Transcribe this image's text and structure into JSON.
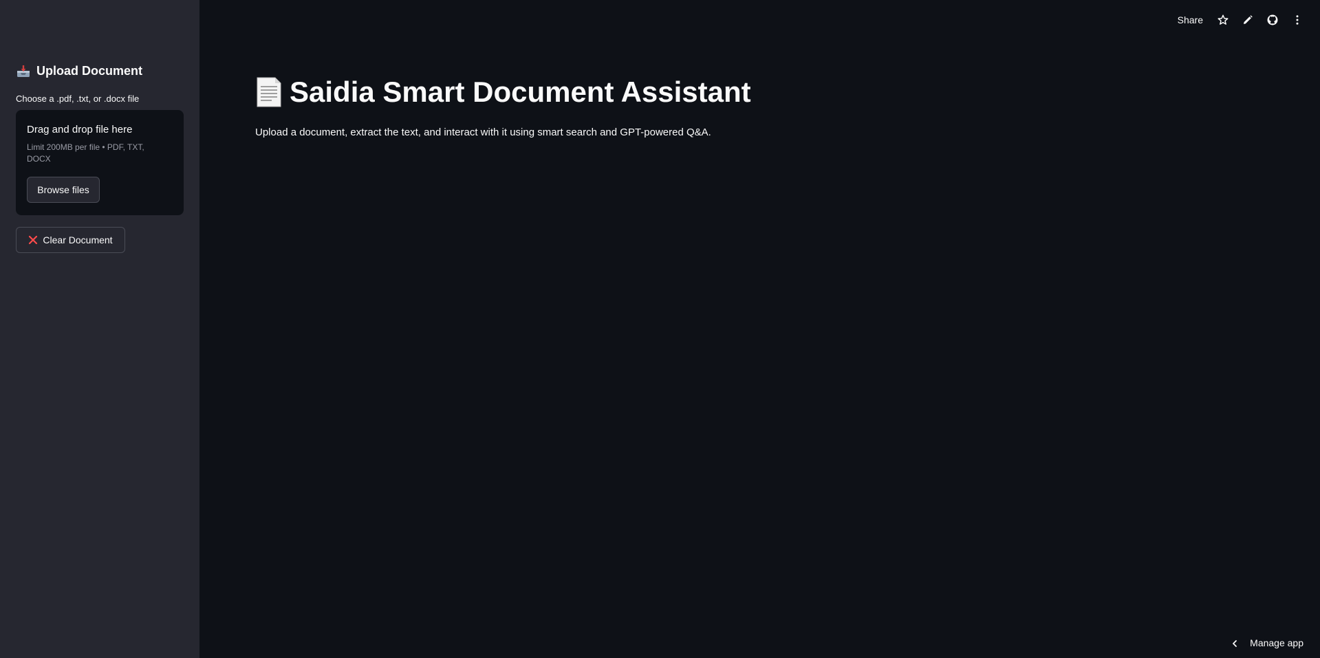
{
  "sidebar": {
    "heading": "Upload Document",
    "heading_icon": "inbox-tray-icon",
    "uploader_label": "Choose a .pdf, .txt, or .docx file",
    "dropzone_title": "Drag and drop file here",
    "dropzone_limit": "Limit 200MB per file • PDF, TXT, DOCX",
    "browse_label": "Browse files",
    "clear_label": "Clear Document",
    "clear_icon": "cross-mark-icon"
  },
  "header": {
    "share_label": "Share",
    "icons": [
      "star-icon",
      "edit-pencil-icon",
      "github-icon",
      "kebab-menu-icon"
    ]
  },
  "main": {
    "title": "Saidia Smart Document Assistant",
    "title_icon": "document-icon",
    "description": "Upload a document, extract the text, and interact with it using smart search and GPT-powered Q&A."
  },
  "footer": {
    "manage_label": "Manage app"
  },
  "colors": {
    "background": "#0e1117",
    "sidebar": "#262730",
    "text": "#fafafa",
    "muted": "#9a9ca6",
    "accent_red": "#ff4b4b"
  }
}
